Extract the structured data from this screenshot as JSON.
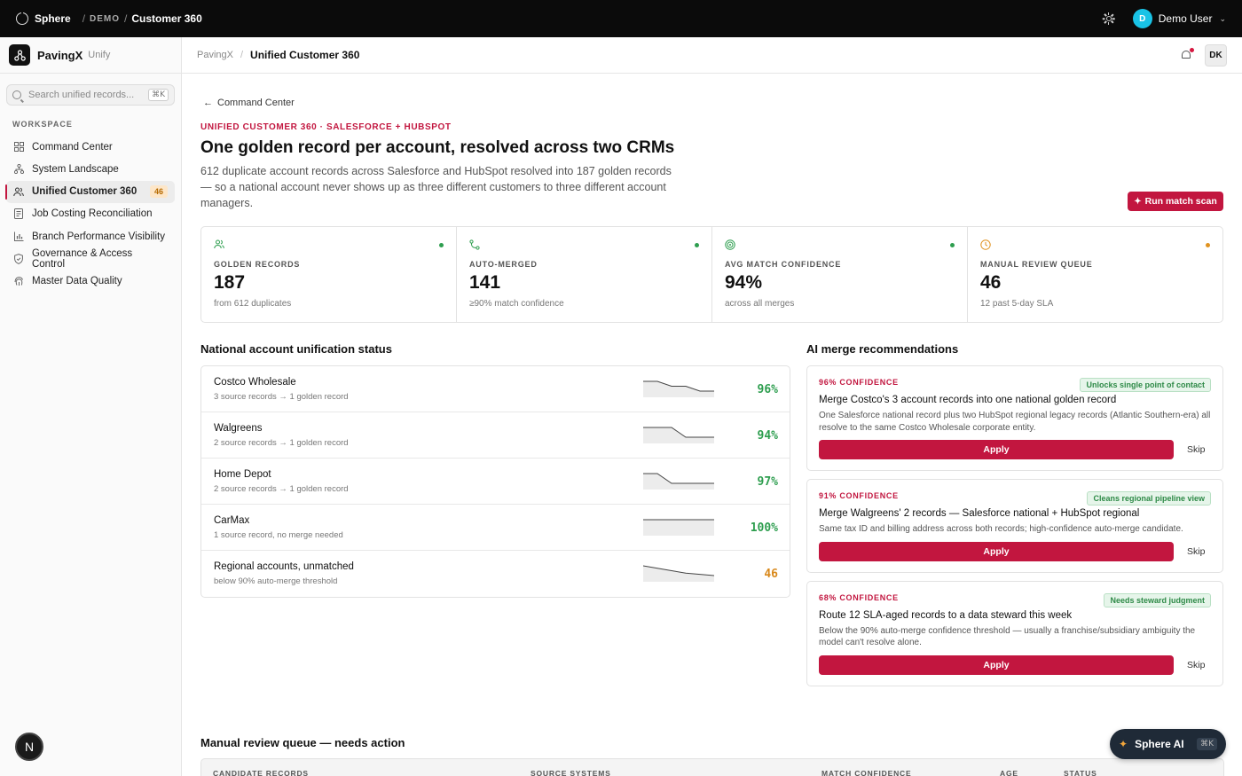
{
  "topbar": {
    "brand": "Sphere",
    "env": "DEMO",
    "page": "Customer 360",
    "user_initial": "D",
    "user_name": "Demo User"
  },
  "sidebar": {
    "org_name": "PavingX",
    "org_sub": "Unify",
    "search_placeholder": "Search unified records...",
    "search_shortcut": "⌘K",
    "section_label": "WORKSPACE",
    "items": [
      {
        "label": "Command Center",
        "icon": "grid-icon"
      },
      {
        "label": "System Landscape",
        "icon": "network-icon"
      },
      {
        "label": "Unified Customer 360",
        "icon": "users-icon",
        "badge": "46",
        "active": true
      },
      {
        "label": "Job Costing Reconciliation",
        "icon": "receipt-icon"
      },
      {
        "label": "Branch Performance Visibility",
        "icon": "bar-chart-icon"
      },
      {
        "label": "Governance & Access Control",
        "icon": "shield-icon"
      },
      {
        "label": "Master Data Quality",
        "icon": "fingerprint-icon"
      }
    ],
    "fab_label": "N"
  },
  "header": {
    "crumb": "PavingX",
    "title": "Unified Customer 360",
    "avatar": "DK"
  },
  "page": {
    "back_label": "Command Center",
    "eyebrow": "UNIFIED CUSTOMER 360 · SALESFORCE + HUBSPOT",
    "title": "One golden record per account, resolved across two CRMs",
    "description": "612 duplicate account records across Salesforce and HubSpot resolved into 187 golden records — so a national account never shows up as three different customers to three different account managers.",
    "run_button": "Run match scan"
  },
  "kpis": [
    {
      "label": "GOLDEN RECORDS",
      "value": "187",
      "sub": "from 612 duplicates",
      "icon": "users-icon",
      "color": "#2e9e4f"
    },
    {
      "label": "AUTO-MERGED",
      "value": "141",
      "sub": "≥90% match confidence",
      "icon": "merge-icon",
      "color": "#2e9e4f"
    },
    {
      "label": "AVG MATCH CONFIDENCE",
      "value": "94%",
      "sub": "across all merges",
      "icon": "target-icon",
      "color": "#2e9e4f"
    },
    {
      "label": "MANUAL REVIEW QUEUE",
      "value": "46",
      "sub": "12 past 5-day SLA",
      "icon": "clock-icon",
      "color": "#e0921f"
    }
  ],
  "status": {
    "title": "National account unification status",
    "rows": [
      {
        "name": "Costco Wholesale",
        "sub": "3 source records → 1 golden record",
        "value": "96%",
        "color": "#2e9e4f",
        "trend": [
          3,
          3,
          2,
          2,
          1,
          1
        ]
      },
      {
        "name": "Walgreens",
        "sub": "2 source records → 1 golden record",
        "value": "94%",
        "color": "#2e9e4f",
        "trend": [
          2,
          2,
          2,
          1,
          1,
          1
        ]
      },
      {
        "name": "Home Depot",
        "sub": "2 source records → 1 golden record",
        "value": "97%",
        "color": "#2e9e4f",
        "trend": [
          2,
          2,
          1,
          1,
          1,
          1
        ]
      },
      {
        "name": "CarMax",
        "sub": "1 source record, no merge needed",
        "value": "100%",
        "color": "#2e9e4f",
        "trend": [
          1,
          1,
          1,
          1,
          1,
          1
        ]
      },
      {
        "name": "Regional accounts, unmatched",
        "sub": "below 90% auto-merge threshold",
        "value": "46",
        "color": "#d9891c",
        "trend": [
          50,
          49,
          48,
          47,
          46.5,
          46
        ]
      }
    ]
  },
  "recommendations": {
    "title": "AI merge recommendations",
    "items": [
      {
        "confidence": "96% CONFIDENCE",
        "tag": "Unlocks single point of contact",
        "title": "Merge Costco's 3 account records into one national golden record",
        "desc": "One Salesforce national record plus two HubSpot regional legacy records (Atlantic Southern-era) all resolve to the same Costco Wholesale corporate entity.",
        "apply": "Apply",
        "skip": "Skip"
      },
      {
        "confidence": "91% CONFIDENCE",
        "tag": "Cleans regional pipeline view",
        "title": "Merge Walgreens' 2 records — Salesforce national + HubSpot regional",
        "desc": "Same tax ID and billing address across both records; high-confidence auto-merge candidate.",
        "apply": "Apply",
        "skip": "Skip"
      },
      {
        "confidence": "68% CONFIDENCE",
        "tag": "Needs steward judgment",
        "title": "Route 12 SLA-aged records to a data steward this week",
        "desc": "Below the 90% auto-merge confidence threshold — usually a franchise/subsidiary ambiguity the model can't resolve alone.",
        "apply": "Apply",
        "skip": "Skip"
      }
    ]
  },
  "queue": {
    "title": "Manual review queue — needs action",
    "columns": [
      "CANDIDATE RECORDS",
      "SOURCE SYSTEMS",
      "MATCH CONFIDENCE",
      "AGE",
      "STATUS"
    ]
  },
  "ai": {
    "label": "Sphere AI",
    "shortcut": "⌘K"
  }
}
